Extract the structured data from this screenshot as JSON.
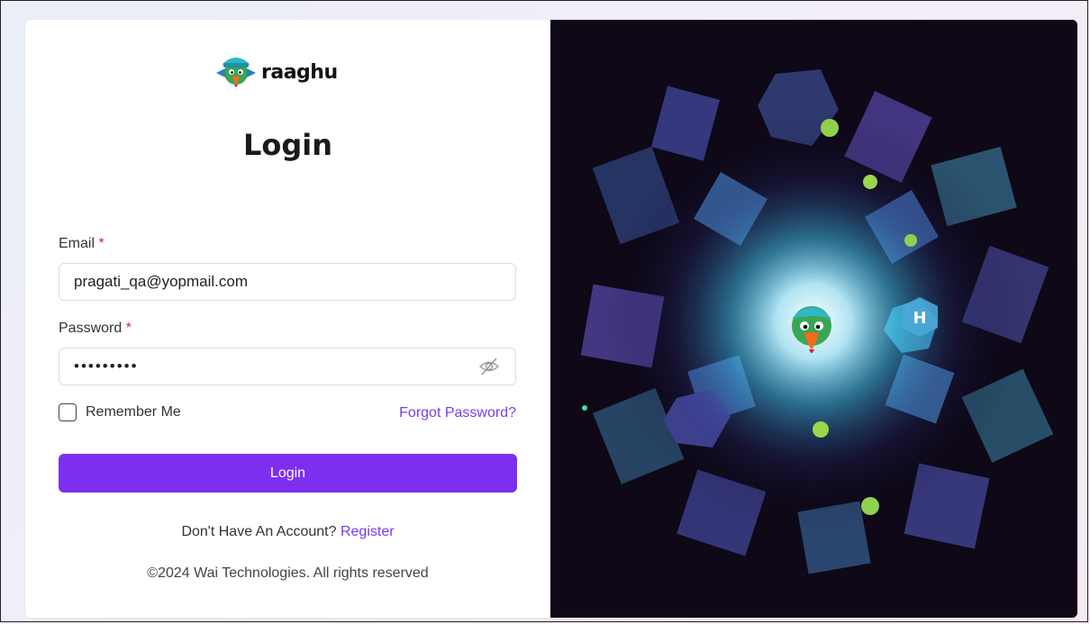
{
  "brand": {
    "name": "raaghu"
  },
  "page": {
    "title": "Login"
  },
  "form": {
    "email_label": "Email",
    "email_required": "*",
    "email_value": "pragati_qa@yopmail.com",
    "password_label": "Password",
    "password_required": "*",
    "password_value": "qwertyuio",
    "remember_label": "Remember Me",
    "remember_checked": false,
    "forgot_label": "Forgot Password?",
    "login_label": "Login"
  },
  "footer": {
    "register_prompt": "Don't Have An Account?",
    "register_link": "Register",
    "copyright": "©2024 Wai Technologies. All rights reserved"
  },
  "colors": {
    "accent": "#7d2ff0",
    "link": "#7c3aed",
    "required": "#e0242e",
    "hero_bg": "#0e0817"
  },
  "icons": {
    "logo": "parrot-mascot-icon",
    "password_toggle": "eye-off-icon"
  }
}
